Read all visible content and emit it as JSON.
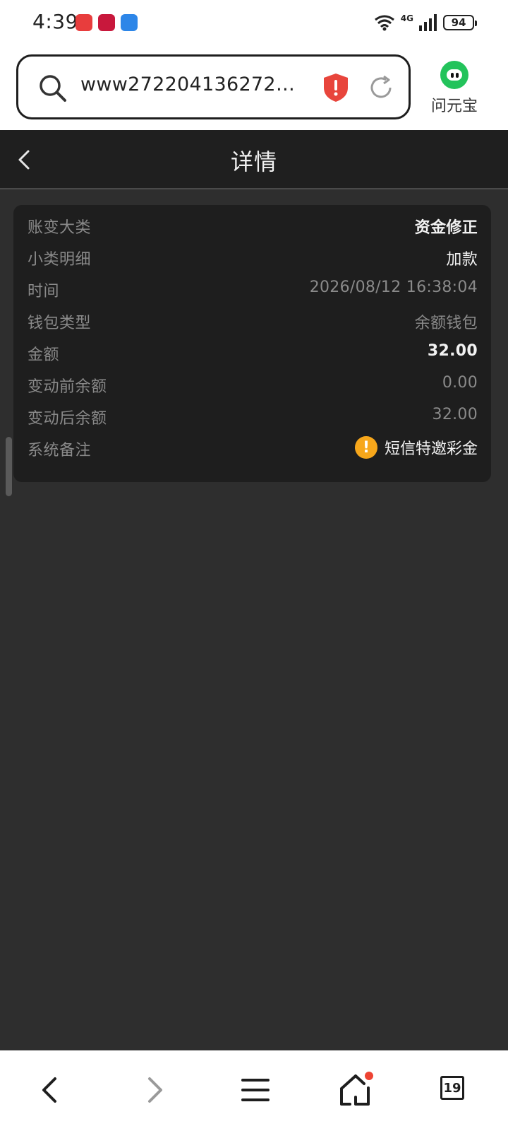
{
  "status_bar": {
    "time": "4:39",
    "network": "4G",
    "battery": "94",
    "app_icons": [
      "game-app-icon",
      "music-app-icon",
      "wifi-tool-app-icon"
    ]
  },
  "browser": {
    "url": "www272204136272.k...",
    "assistant_label": "问元宝"
  },
  "header": {
    "title": "详情"
  },
  "details": {
    "category_label": "账变大类",
    "category_value": "资金修正",
    "subcategory_label": "小类明细",
    "subcategory_value": "加款",
    "time_label": "时间",
    "time_value": "2026/08/12 16:38:04",
    "wallet_label": "钱包类型",
    "wallet_value": "余额钱包",
    "amount_label": "金额",
    "amount_value": "32.00",
    "before_label": "变动前余额",
    "before_value": "0.00",
    "after_label": "变动后余额",
    "after_value": "32.00",
    "note_label": "系统备注",
    "note_value": "短信特邀彩金"
  },
  "bottom_nav": {
    "tab_count": "19"
  },
  "colors": {
    "page_bg": "#2e2e2e",
    "card_bg": "#1e1e1e",
    "header_bg": "#1f1f1f",
    "warning": "#f7a71b",
    "shield_red": "#e8453c",
    "assistant_green": "#23c35b"
  }
}
